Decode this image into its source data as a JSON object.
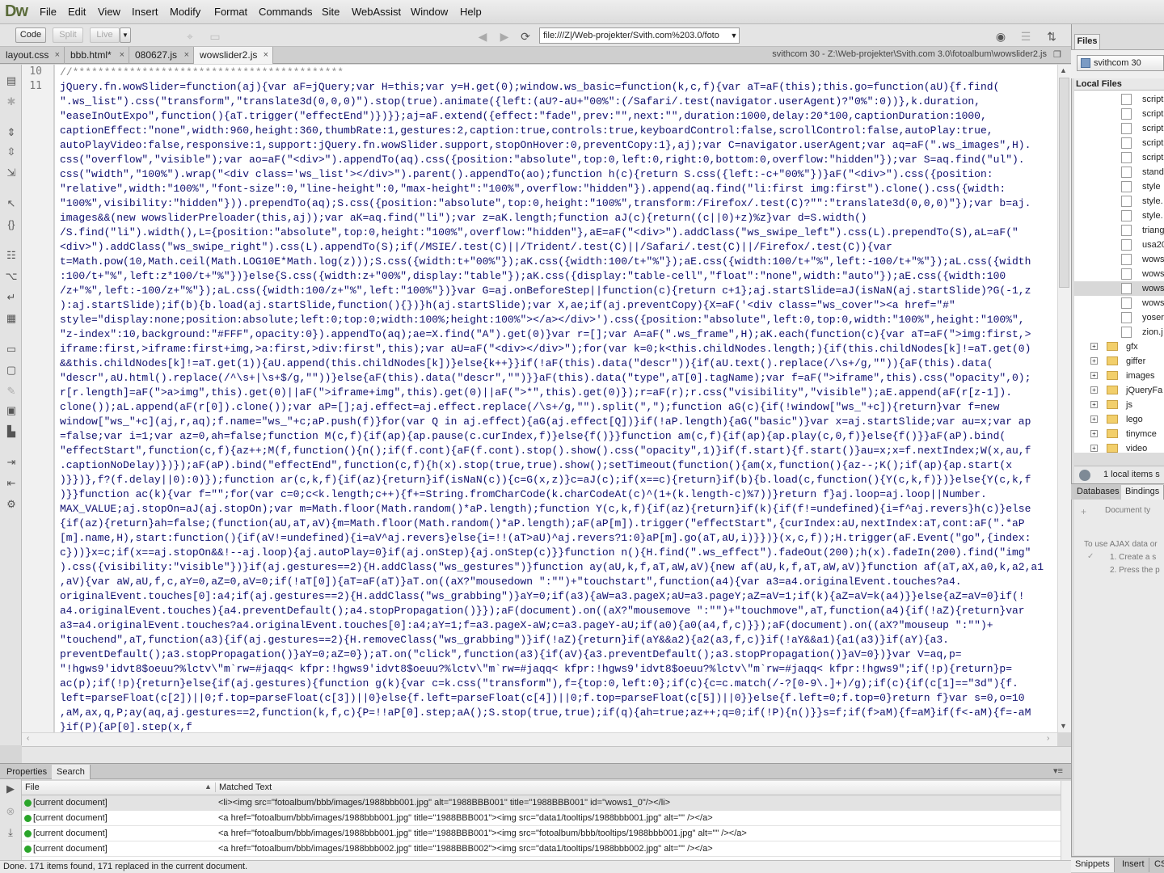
{
  "app": {
    "logo": "Dw"
  },
  "menu": [
    "File",
    "Edit",
    "View",
    "Insert",
    "Modify",
    "Format",
    "Commands",
    "Site",
    "WebAssist",
    "Window",
    "Help"
  ],
  "toolbar": {
    "code_label": "Code",
    "split_label": "Split",
    "live_label": "Live",
    "address": "file:///Z|/Web-projekter/Svith.com%203.0/foto"
  },
  "tabs": [
    {
      "label": "layout.css"
    },
    {
      "label": "bbb.html*"
    },
    {
      "label": "080627.js"
    },
    {
      "label": "wowslider2.js"
    }
  ],
  "path_info": "svithcom 30 - Z:\\Web-projekter\\Svith.com 3.0\\fotoalbum\\wowslider2.js",
  "editor": {
    "line_numbers": [
      "10",
      "11"
    ],
    "lines": [
      "//*******************************************",
      "jQuery.fn.wowSlider=function(aj){var aF=jQuery;var H=this;var y=H.get(0);window.ws_basic=function(k,c,f){var aT=aF(this);this.go=function(aU){f.find(",
      "\".ws_list\").css(\"transform\",\"translate3d(0,0,0)\").stop(true).animate({left:(aU?-aU+\"00%\":(/Safari/.test(navigator.userAgent)?\"0%\":0))},k.duration,",
      "\"easeInOutExpo\",function(){aT.trigger(\"effectEnd\")})}};aj=aF.extend({effect:\"fade\",prev:\"\",next:\"\",duration:1000,delay:20*100,captionDuration:1000,",
      "captionEffect:\"none\",width:960,height:360,thumbRate:1,gestures:2,caption:true,controls:true,keyboardControl:false,scrollControl:false,autoPlay:true,",
      "autoPlayVideo:false,responsive:1,support:jQuery.fn.wowSlider.support,stopOnHover:0,preventCopy:1},aj);var C=navigator.userAgent;var aq=aF(\".ws_images\",H).",
      "css(\"overflow\",\"visible\");var ao=aF(\"<div>\").appendTo(aq).css({position:\"absolute\",top:0,left:0,right:0,bottom:0,overflow:\"hidden\"});var S=aq.find(\"ul\").",
      "css(\"width\",\"100%\").wrap(\"<div class='ws_list'></div>\").parent().appendTo(ao);function h(c){return S.css({left:-c+\"00%\"})}aF(\"<div>\").css({position:",
      "\"relative\",width:\"100%\",\"font-size\":0,\"line-height\":0,\"max-height\":\"100%\",overflow:\"hidden\"}).append(aq.find(\"li:first img:first\").clone().css({width:",
      "\"100%\",visibility:\"hidden\"})).prependTo(aq);S.css({position:\"absolute\",top:0,height:\"100%\",transform:/Firefox/.test(C)?\"\":\"translate3d(0,0,0)\"});var b=aj.",
      "images&&(new wowsliderPreloader(this,aj));var aK=aq.find(\"li\");var z=aK.length;function aJ(c){return((c||0)+z)%z}var d=S.width()",
      "/S.find(\"li\").width(),L={position:\"absolute\",top:0,height:\"100%\",overflow:\"hidden\"},aE=aF(\"<div>\").addClass(\"ws_swipe_left\").css(L).prependTo(S),aL=aF(\"",
      "<div>\").addClass(\"ws_swipe_right\").css(L).appendTo(S);if(/MSIE/.test(C)||/Trident/.test(C)||/Safari/.test(C)||/Firefox/.test(C)){var",
      "t=Math.pow(10,Math.ceil(Math.LOG10E*Math.log(z)));S.css({width:t+\"00%\"});aK.css({width:100/t+\"%\"});aE.css({width:100/t+\"%\",left:-100/t+\"%\"});aL.css({width",
      ":100/t+\"%\",left:z*100/t+\"%\"})}else{S.css({width:z+\"00%\",display:\"table\"});aK.css({display:\"table-cell\",\"float\":\"none\",width:\"auto\"});aE.css({width:100",
      "/z+\"%\",left:-100/z+\"%\"});aL.css({width:100/z+\"%\",left:\"100%\"})}var G=aj.onBeforeStep||function(c){return c+1};aj.startSlide=aJ(isNaN(aj.startSlide)?G(-1,z",
      "):aj.startSlide);if(b){b.load(aj.startSlide,function(){})}h(aj.startSlide);var X,ae;if(aj.preventCopy){X=aF('<div class=\"ws_cover\"><a href=\"#\"",
      "style=\"display:none;position:absolute;left:0;top:0;width:100%;height:100%\"></a></div>').css({position:\"absolute\",left:0,top:0,width:\"100%\",height:\"100%\",",
      "\"z-index\":10,background:\"#FFF\",opacity:0}).appendTo(aq);ae=X.find(\"A\").get(0)}var r=[];var A=aF(\".ws_frame\",H);aK.each(function(c){var aT=aF(\">img:first,>",
      "iframe:first,>iframe:first+img,>a:first,>div:first\",this);var aU=aF(\"<div></div>\");for(var k=0;k<this.childNodes.length;){if(this.childNodes[k]!=aT.get(0)",
      "&&this.childNodes[k]!=aT.get(1)){aU.append(this.childNodes[k])}else{k++}}if(!aF(this).data(\"descr\")){if(aU.text().replace(/\\s+/g,\"\")){aF(this).data(",
      "\"descr\",aU.html().replace(/^\\s+|\\s+$/g,\"\"))}else{aF(this).data(\"descr\",\"\")}}aF(this).data(\"type\",aT[0].tagName);var f=aF(\">iframe\",this).css(\"opacity\",0);",
      "r[r.length]=aF(\">a>img\",this).get(0)||aF(\">iframe+img\",this).get(0)||aF(\">*\",this).get(0)});r=aF(r);r.css(\"visibility\",\"visible\");aE.append(aF(r[z-1]).",
      "clone());aL.append(aF(r[0]).clone());var aP=[];aj.effect=aj.effect.replace(/\\s+/g,\"\").split(\",\");function aG(c){if(!window[\"ws_\"+c]){return}var f=new",
      "window[\"ws_\"+c](aj,r,aq);f.name=\"ws_\"+c;aP.push(f)}for(var Q in aj.effect){aG(aj.effect[Q])}if(!aP.length){aG(\"basic\")}var x=aj.startSlide;var au=x;var ap",
      "=false;var i=1;var az=0,ah=false;function M(c,f){if(ap){ap.pause(c.curIndex,f)}else{f()}}function am(c,f){if(ap){ap.play(c,0,f)}else{f()}}aF(aP).bind(",
      "\"effectStart\",function(c,f){az++;M(f,function(){n();if(f.cont){aF(f.cont).stop().show().css(\"opacity\",1)}if(f.start){f.start()}au=x;x=f.nextIndex;W(x,au,f",
      ".captionNoDelay)})});aF(aP).bind(\"effectEnd\",function(c,f){h(x).stop(true,true).show();setTimeout(function(){am(x,function(){az--;K();if(ap){ap.start(x",
      ")}})},f?(f.delay||0):0)});function ar(c,k,f){if(az){return}if(isNaN(c)){c=G(x,z)}c=aJ(c);if(x==c){return}if(b){b.load(c,function(){Y(c,k,f)})}else{Y(c,k,f",
      ")}}function ac(k){var f=\"\";for(var c=0;c<k.length;c++){f+=String.fromCharCode(k.charCodeAt(c)^(1+(k.length-c)%7))}return f}aj.loop=aj.loop||Number.",
      "MAX_VALUE;aj.stopOn=aJ(aj.stopOn);var m=Math.floor(Math.random()*aP.length);function Y(c,k,f){if(az){return}if(k){if(f!=undefined){i=f^aj.revers}h(c)}else",
      "{if(az){return}ah=false;(function(aU,aT,aV){m=Math.floor(Math.random()*aP.length);aF(aP[m]).trigger(\"effectStart\",{curIndex:aU,nextIndex:aT,cont:aF(\".*aP",
      "[m].name,H),start:function(){if(aV!=undefined){i=aV^aj.revers}else{i=!!(aT>aU)^aj.revers?1:0}aP[m].go(aT,aU,i)}})}(x,c,f));H.trigger(aF.Event(\"go\",{index:",
      "c}))}x=c;if(x==aj.stopOn&&!--aj.loop){aj.autoPlay=0}if(aj.onStep){aj.onStep(c)}}function n(){H.find(\".ws_effect\").fadeOut(200);h(x).fadeIn(200).find(\"img\"",
      ").css({visibility:\"visible\"})}if(aj.gestures==2){H.addClass(\"ws_gestures\")}function ay(aU,k,f,aT,aW,aV){new af(aU,k,f,aT,aW,aV)}function af(aT,aX,a0,k,a2,a1",
      ",aV){var aW,aU,f,c,aY=0,aZ=0,aV=0;if(!aT[0]){aT=aF(aT)}aT.on((aX?\"mousedown \":\"\")+\"touchstart\",function(a4){var a3=a4.originalEvent.touches?a4.",
      "originalEvent.touches[0]:a4;if(aj.gestures==2){H.addClass(\"ws_grabbing\")}aY=0;if(a3){aW=a3.pageX;aU=a3.pageY;aZ=aV=1;if(k){aZ=aV=k(a4)}}else{aZ=aV=0}if(!",
      "a4.originalEvent.touches){a4.preventDefault();a4.stopPropagation()}});aF(document).on((aX?\"mousemove \":\"\")+\"touchmove\",aT,function(a4){if(!aZ){return}var",
      "a3=a4.originalEvent.touches?a4.originalEvent.touches[0]:a4;aY=1;f=a3.pageX-aW;c=a3.pageY-aU;if(a0){a0(a4,f,c)}});aF(document).on((aX?\"mouseup \":\"\")+",
      "\"touchend\",aT,function(a3){if(aj.gestures==2){H.removeClass(\"ws_grabbing\")}if(!aZ){return}if(aY&&a2){a2(a3,f,c)}if(!aY&&a1){a1(a3)}if(aY){a3.",
      "preventDefault();a3.stopPropagation()}aY=0;aZ=0});aT.on(\"click\",function(a3){if(aV){a3.preventDefault();a3.stopPropagation()}aV=0})}var V=aq,p=",
      "\"!hgws9'idvt8$oeuu?%lctv\\\"m`rw=#jaqq< kfpr:!hgws9'idvt8$oeuu?%lctv\\\"m`rw=#jaqq< kfpr:!hgws9'idvt8$oeuu?%lctv\\\"m`rw=#jaqq< kfpr:!hgws9\";if(!p){return}p=",
      "ac(p);if(!p){return}else{if(aj.gestures){function g(k){var c=k.css(\"transform\"),f={top:0,left:0};if(c){c=c.match(/-?[0-9\\.]+)/g);if(c){if(c[1]==\"3d\"){f.",
      "left=parseFloat(c[2])||0;f.top=parseFloat(c[3])||0}else{f.left=parseFloat(c[4])||0;f.top=parseFloat(c[5])||0}}else{f.left=0;f.top=0}return f}var s=0,o=10",
      ",aM,ax,q,P;ay(aq,aj.gestures==2,function(k,f,c){P=!!aP[0].step;aA();S.stop(true,true);if(q){ah=true;az++;q=0;if(!P){n()}}s=f;if(f>aM){f=aM}if(f<-aM){f=-aM",
      "}if(P){aP[0].step(x,f"
    ]
  },
  "bottom_panel": {
    "tabs": [
      "Properties",
      "Search"
    ],
    "col_file": "File",
    "col_text": "Matched Text",
    "rows": [
      {
        "file": "[current document]",
        "text": "<li><img src=\"fotoalbum/bbb/images/1988bbb001.jpg\" alt=\"1988BBB001\" title=\"1988BBB001\" id=\"wows1_0\"/></li>"
      },
      {
        "file": "[current document]",
        "text": "<a href=\"fotoalbum/bbb/images/1988bbb001.jpg\" title=\"1988BBB001\"><img src=\"data1/tooltips/1988bbb001.jpg\" alt=\"\" /></a>"
      },
      {
        "file": "[current document]",
        "text": "<a href=\"fotoalbum/bbb/images/1988bbb001.jpg\" title=\"1988BBB001\"><img src=\"fotoalbum/bbb/tooltips/1988bbb001.jpg\" alt=\"\" /></a>"
      },
      {
        "file": "[current document]",
        "text": "<a href=\"fotoalbum/bbb/images/1988bbb002.jpg\" title=\"1988BBB002\"><img src=\"data1/tooltips/1988bbb002.jpg\" alt=\"\" /></a>"
      }
    ]
  },
  "status": "Done. 171 items found, 171 replaced in the current document.",
  "files_panel": {
    "tab": "Files",
    "site": "svithcom 30",
    "local_files": "Local Files",
    "files": [
      "script",
      "script",
      "script",
      "script",
      "script",
      "stand",
      "style",
      "style.",
      "style.",
      "triang",
      "usa20",
      "wows",
      "wows",
      "wows",
      "wows",
      "yoser",
      "zion.j"
    ],
    "folders": [
      "gfx",
      "giffer",
      "images",
      "jQueryFa",
      "js",
      "lego",
      "tinymce",
      "video"
    ],
    "count": "1 local items s"
  },
  "db_panel": {
    "tabs": [
      "Databases",
      "Bindings"
    ],
    "doc_type": "Document ty",
    "hint": "To use AJAX data or",
    "step1": "1. Create a s",
    "step2": "2. Press the p"
  },
  "snippets_tabs": [
    "Snippets",
    "Insert",
    "CS"
  ]
}
